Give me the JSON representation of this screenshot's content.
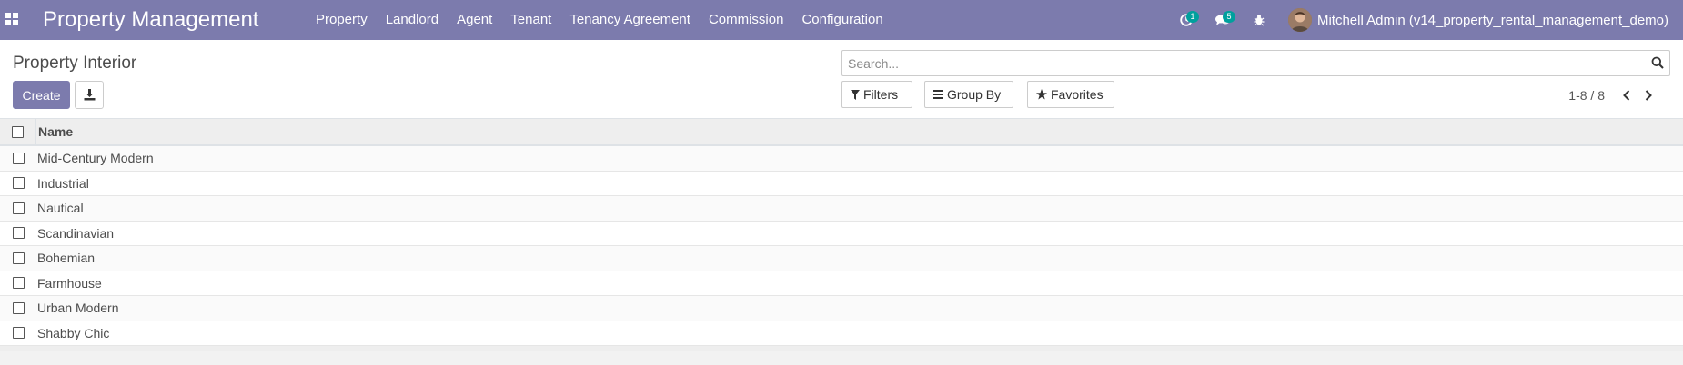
{
  "app": {
    "title": "Property Management",
    "menu": [
      "Property",
      "Landlord",
      "Agent",
      "Tenant",
      "Tenancy Agreement",
      "Commission",
      "Configuration"
    ]
  },
  "systray": {
    "activity_count": "1",
    "messages_count": "5",
    "user_name": "Mitchell Admin (v14_property_rental_management_demo)"
  },
  "control_panel": {
    "breadcrumb": "Property Interior",
    "create_label": "Create",
    "search_placeholder": "Search...",
    "filters_label": "Filters",
    "group_by_label": "Group By",
    "favorites_label": "Favorites",
    "pager_value": "1-8 / 8"
  },
  "list": {
    "column_name": "Name",
    "rows": [
      "Mid-Century Modern",
      "Industrial",
      "Nautical",
      "Scandinavian",
      "Bohemian",
      "Farmhouse",
      "Urban Modern",
      "Shabby Chic"
    ]
  },
  "colors": {
    "navbar": "#7c7bad",
    "primary_button": "#7c7bad",
    "badge": "#00a09d"
  }
}
